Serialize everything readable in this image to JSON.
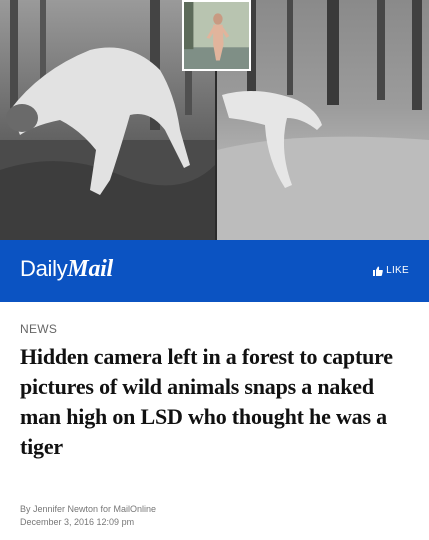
{
  "brand": {
    "daily": "Daily",
    "mail": "Mail",
    "color": "#0b53c2"
  },
  "like_button": {
    "icon": "thumbs-up-icon",
    "label": "LIKE"
  },
  "article": {
    "section": "NEWS",
    "headline": "Hidden camera left in a forest to capture pictures of wild animals snaps a naked man high on LSD who thought he was a tiger",
    "byline": "By Jennifer Newton for MailOnline",
    "date": "December 3, 2016 12:09 pm"
  }
}
